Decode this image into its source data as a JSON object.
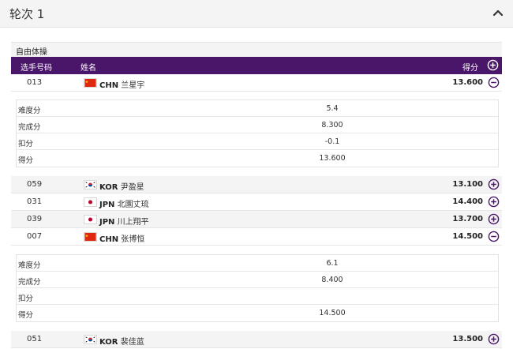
{
  "round": {
    "title": "轮次 1"
  },
  "event": {
    "title": "自由体操"
  },
  "header": {
    "num": "选手号码",
    "name": "姓名",
    "score": "得分"
  },
  "colors": {
    "header_bg": "#4a1669",
    "icon": "#4a1669"
  },
  "athletes": [
    {
      "num": "013",
      "country": "CHN",
      "name": "兰星宇",
      "score": "13.600",
      "expanded": true
    },
    {
      "num": "059",
      "country": "KOR",
      "name": "尹盈星",
      "score": "13.100",
      "expanded": false
    },
    {
      "num": "031",
      "country": "JPN",
      "name": "北園丈琉",
      "score": "14.400",
      "expanded": false
    },
    {
      "num": "039",
      "country": "JPN",
      "name": "川上翔平",
      "score": "13.700",
      "expanded": false
    },
    {
      "num": "007",
      "country": "CHN",
      "name": "张博恒",
      "score": "14.500",
      "expanded": true
    },
    {
      "num": "051",
      "country": "KOR",
      "name": "裴佳蓝",
      "score": "13.500",
      "expanded": false
    }
  ],
  "details": [
    {
      "rows": [
        {
          "label": "难度分",
          "value": "5.4"
        },
        {
          "label": "完成分",
          "value": "8.300"
        },
        {
          "label": "扣分",
          "value": "-0.1"
        },
        {
          "label": "得分",
          "value": "13.600"
        }
      ]
    },
    {
      "rows": [
        {
          "label": "难度分",
          "value": "6.1"
        },
        {
          "label": "完成分",
          "value": "8.400"
        },
        {
          "label": "扣分",
          "value": ""
        },
        {
          "label": "得分",
          "value": "14.500"
        }
      ]
    }
  ]
}
